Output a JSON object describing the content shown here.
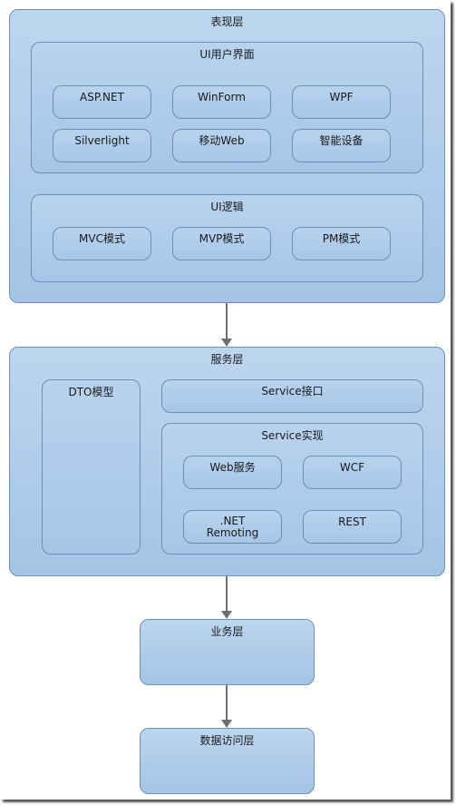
{
  "diagram": {
    "presentation_layer": {
      "title": "表现层",
      "ui_interface": {
        "title": "UI用户界面",
        "items": [
          "ASP.NET",
          "WinForm",
          "WPF",
          "Silverlight",
          "移动Web",
          "智能设备"
        ]
      },
      "ui_logic": {
        "title": "UI逻辑",
        "items": [
          "MVC模式",
          "MVP模式",
          "PM模式"
        ]
      }
    },
    "service_layer": {
      "title": "服务层",
      "dto": "DTO模型",
      "service_interface": "Service接口",
      "service_impl": {
        "title": "Service实现",
        "items": [
          "Web服务",
          "WCF",
          ".NET\nRemoting",
          "REST"
        ]
      }
    },
    "business_layer": {
      "title": "业务层"
    },
    "data_access_layer": {
      "title": "数据访问层"
    },
    "arrows": [
      {
        "from": "表现层",
        "to": "服务层"
      },
      {
        "from": "服务层",
        "to": "业务层"
      },
      {
        "from": "业务层",
        "to": "数据访问层"
      }
    ]
  }
}
